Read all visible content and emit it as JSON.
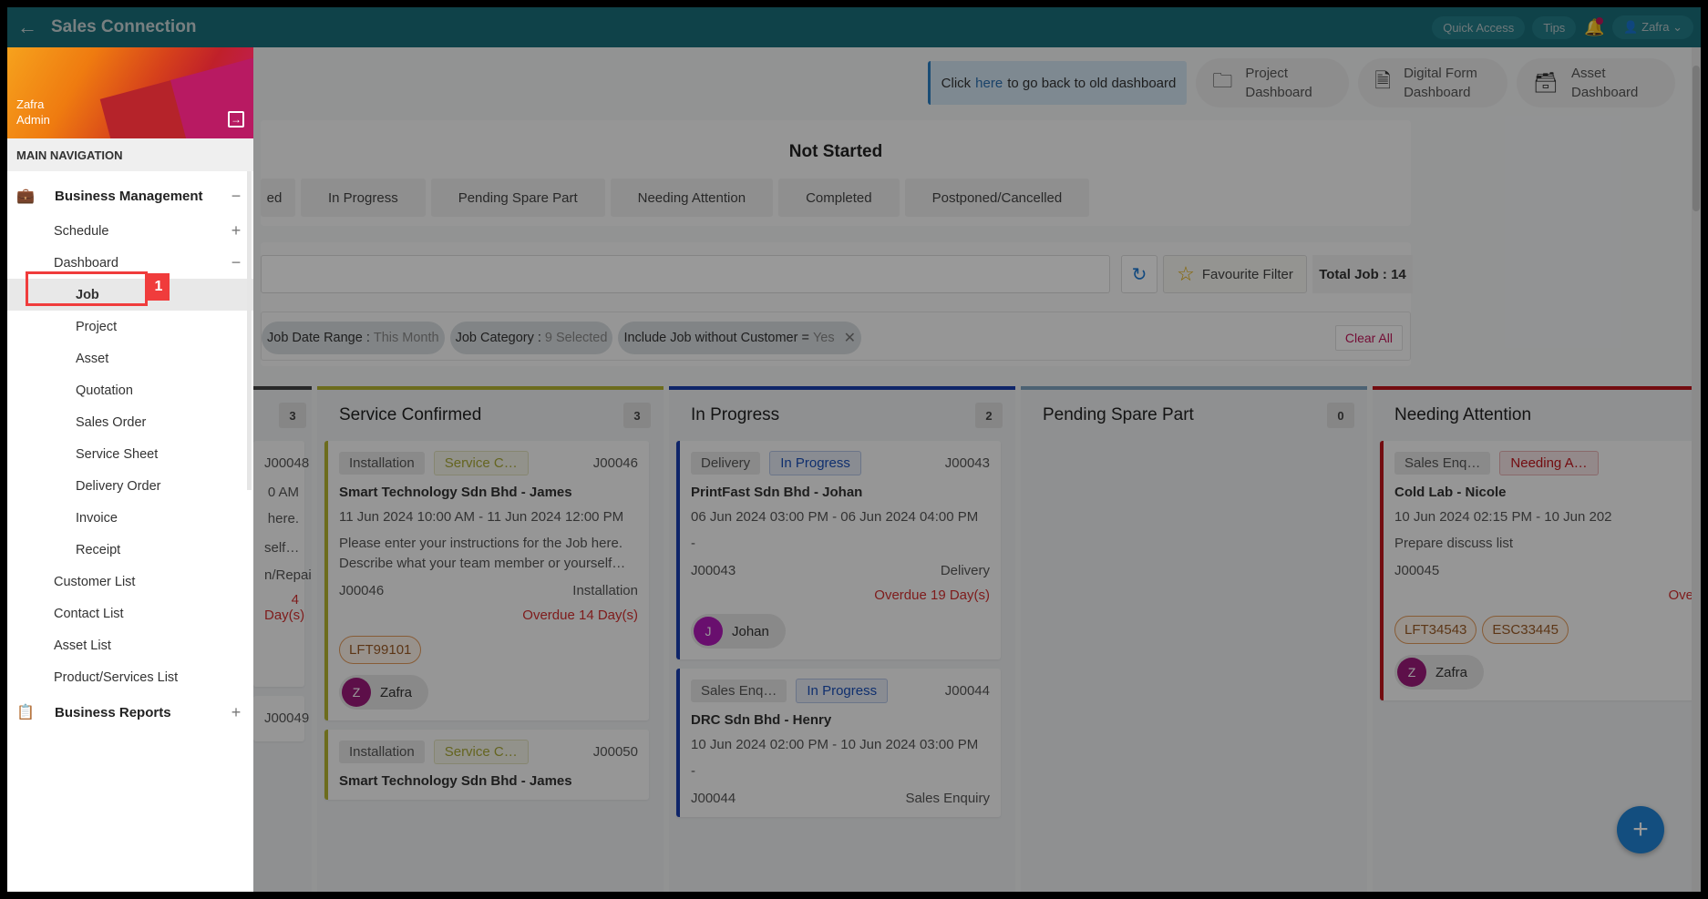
{
  "app": {
    "title": "Sales Connection",
    "quick_access": "Quick Access",
    "tips": "Tips",
    "user": "Zafra"
  },
  "sidebar": {
    "user_name": "Zafra",
    "user_role": "Admin",
    "nav_header": "MAIN NAVIGATION",
    "groups": [
      {
        "label": "Business Management",
        "icon": "briefcase-icon",
        "expanded": true,
        "toggle": "−",
        "items": [
          {
            "label": "Schedule",
            "toggle": "+"
          },
          {
            "label": "Dashboard",
            "toggle": "−",
            "children": [
              {
                "label": "Job",
                "active": true
              },
              {
                "label": "Project"
              },
              {
                "label": "Asset"
              },
              {
                "label": "Quotation"
              },
              {
                "label": "Sales Order"
              },
              {
                "label": "Service Sheet"
              },
              {
                "label": "Delivery Order"
              },
              {
                "label": "Invoice"
              },
              {
                "label": "Receipt"
              }
            ]
          },
          {
            "label": "Customer List"
          },
          {
            "label": "Contact List"
          },
          {
            "label": "Asset List"
          },
          {
            "label": "Product/Services List"
          }
        ]
      },
      {
        "label": "Business Reports",
        "icon": "clipboard-icon",
        "expanded": false,
        "toggle": "+"
      }
    ],
    "annotation_badge": "1"
  },
  "quicklinks": {
    "notice_prefix": "Click",
    "notice_link": "here",
    "notice_suffix": "to go back to old dashboard",
    "buttons": [
      {
        "label1": "Project",
        "label2": "Dashboard",
        "icon": "folder-icon"
      },
      {
        "label1": "Digital Form",
        "label2": "Dashboard",
        "icon": "document-icon"
      },
      {
        "label1": "Asset",
        "label2": "Dashboard",
        "icon": "archive-icon"
      }
    ]
  },
  "status": {
    "heading": "Not Started",
    "tabs": [
      "ed",
      "In Progress",
      "Pending Spare Part",
      "Needing Attention",
      "Completed",
      "Postponed/Cancelled"
    ]
  },
  "filters": {
    "search_value": "",
    "favourite_filter": "Favourite Filter",
    "total_job": "Total Job : 14",
    "chips": [
      {
        "key": "Job Date Range :",
        "value": "This Month",
        "removable": false
      },
      {
        "key": "Job Category :",
        "value": "9 Selected",
        "removable": false
      },
      {
        "key": "Include Job without Customer =",
        "value": "Yes",
        "removable": true
      }
    ],
    "clear_all": "Clear All"
  },
  "board": {
    "columns": [
      {
        "title": "",
        "count": "3",
        "color": "#444444",
        "partial": true,
        "cards": [
          {
            "id": "J00048",
            "dt": "0 AM",
            "desc1": "here.",
            "desc2": "self…",
            "meta_right": "n/Repair",
            "overdue": "4 Day(s)"
          },
          {
            "id": "J00049"
          }
        ]
      },
      {
        "title": "Service Confirmed",
        "count": "3",
        "color": "#b5b531",
        "cards": [
          {
            "type": "Installation",
            "status": "Service C…",
            "status_color": "#a8a836",
            "id": "J00046",
            "customer": "Smart Technology Sdn Bhd - James",
            "dt": "11 Jun 2024 10:00 AM - 11 Jun 2024 12:00 PM",
            "desc": "Please enter your instructions for the Job here. Describe what your team member or yourself…",
            "meta_left": "J00046",
            "meta_right": "Installation",
            "overdue": "Overdue 14 Day(s)",
            "assets": [
              "LFT99101"
            ],
            "assignee": {
              "initial": "Z",
              "name": "Zafra",
              "color": "#9c1a7a"
            }
          },
          {
            "type": "Installation",
            "status": "Service C…",
            "status_color": "#a8a836",
            "id": "J00050",
            "customer": "Smart Technology Sdn Bhd - James"
          }
        ]
      },
      {
        "title": "In Progress",
        "count": "2",
        "color": "#1a3fb0",
        "cards": [
          {
            "type": "Delivery",
            "status": "In Progress",
            "status_color": "#1a4fb8",
            "id": "J00043",
            "customer": "PrintFast Sdn Bhd - Johan",
            "dt": "06 Jun 2024 03:00 PM - 06 Jun 2024 04:00 PM",
            "desc": "-",
            "meta_left": "J00043",
            "meta_right": "Delivery",
            "overdue": "Overdue 19 Day(s)",
            "assignee": {
              "initial": "J",
              "name": "Johan",
              "color": "#b01ab8"
            }
          },
          {
            "type": "Sales Enq…",
            "status": "In Progress",
            "status_color": "#1a4fb8",
            "id": "J00044",
            "customer": "DRC Sdn Bhd - Henry",
            "dt": "10 Jun 2024 02:00 PM - 10 Jun 2024 03:00 PM",
            "desc": "-",
            "meta_left": "J00044",
            "meta_right": "Sales Enquiry"
          }
        ]
      },
      {
        "title": "Pending Spare Part",
        "count": "0",
        "color": "#7fa3c0",
        "cards": []
      },
      {
        "title": "Needing Attention",
        "count": "",
        "color": "#c0141c",
        "cards": [
          {
            "type": "Sales Enq…",
            "status": "Needing A…",
            "status_color": "#c0141c",
            "id": "",
            "customer": "Cold Lab - Nicole",
            "dt": "10 Jun 2024 02:15 PM - 10 Jun 202",
            "desc": "Prepare discuss list",
            "meta_left": "J00045",
            "meta_right": "",
            "overdue": "Ove",
            "assets": [
              "LFT34543",
              "ESC33445"
            ],
            "assignee": {
              "initial": "Z",
              "name": "Zafra",
              "color": "#9c1a7a"
            }
          }
        ]
      }
    ],
    "fab": "+"
  }
}
